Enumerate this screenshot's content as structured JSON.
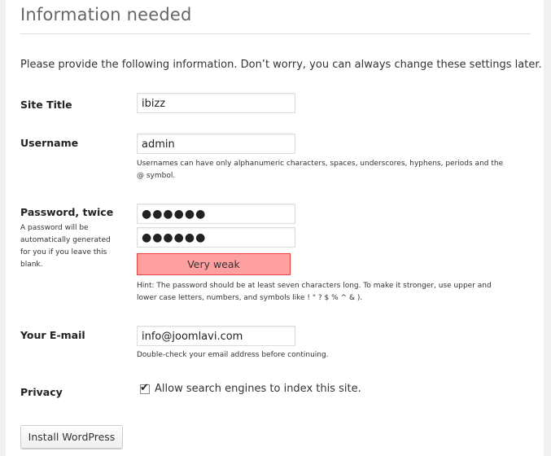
{
  "page": {
    "title": "Information needed",
    "intro": "Please provide the following information. Don’t worry, you can always change these settings later."
  },
  "fields": {
    "site_title": {
      "label": "Site Title",
      "value": "ibizz"
    },
    "username": {
      "label": "Username",
      "value": "admin",
      "help_line1": "Usernames can have only alphanumeric characters, spaces, underscores, hyphens, periods and the",
      "help_line2": "@ symbol."
    },
    "password": {
      "label": "Password, twice",
      "note_line1": "A password will be",
      "note_line2": "automatically generated",
      "note_line3": "for you if you leave this",
      "note_line4": "blank.",
      "masked_value_1": "●●●●●●",
      "masked_value_2": "●●●●●●",
      "strength_label": "Very weak",
      "hint_line1": "Hint: The password should be at least seven characters long. To make it stronger, use upper and",
      "hint_line2": "lower case letters, numbers, and symbols like ! \" ? $ % ^ & )."
    },
    "email": {
      "label": "Your E-mail",
      "value": "info@joomlavi.com",
      "help": "Double-check your email address before continuing."
    },
    "privacy": {
      "label": "Privacy",
      "checkbox_label": "Allow search engines to index this site.",
      "checked": true,
      "check_glyph": "✔"
    }
  },
  "actions": {
    "install_label": "Install WordPress"
  },
  "colors": {
    "strength_bg": "#ffa0a0",
    "strength_border": "#f04040"
  }
}
